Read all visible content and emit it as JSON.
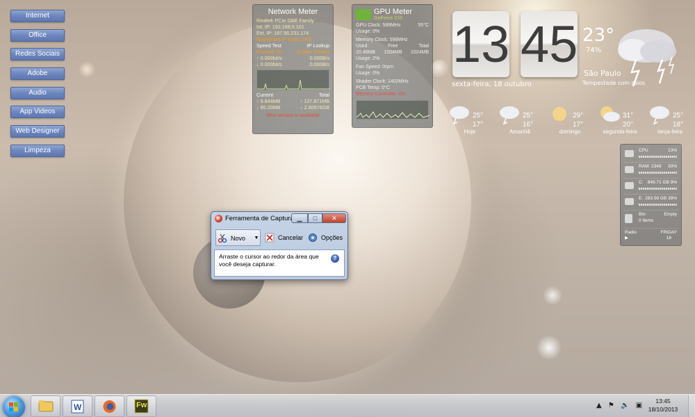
{
  "launcher": {
    "items": [
      "Internet",
      "Office",
      "Redes Sociais",
      "Adobe",
      "Audio",
      "App Videos",
      "Web Designer",
      "Limpeza"
    ]
  },
  "network_meter": {
    "title": "Network Meter",
    "adapter": "Realtek PCIe GBE Family",
    "int_ip": "Int. IP: 192.168.0.101",
    "ext_ip": "Ext. IP: 187.56.231.174",
    "blacklist": "Blacklisted IP Ratio: 2/69",
    "speed_test": "Speed Test",
    "ip_lookup": "IP Lookup",
    "firewall": "Firewall: On",
    "profile": "Profile: Private",
    "up_bit": "0.000bit/s",
    "up_b": "0.000B/s",
    "down_bit": "0.000bit/s",
    "down_b": "0.000B/s",
    "current_label": "Current",
    "total_label": "Total",
    "cur_up": "9.844MB",
    "tot_up": "137.871MB",
    "cur_down": "86.20MB",
    "tot_down": "2.60676GB",
    "new_version": "New version is available"
  },
  "gpu_meter": {
    "title": "GPU Meter",
    "model": "GeForce 210",
    "gpu_clock": "GPU Clock: 589MHz",
    "gpu_temp": "55°C",
    "usage1": "Usage: 0%",
    "memory_clock": "Memory Clock: 598MHz",
    "col_used": "Used",
    "col_free": "Free",
    "col_total": "Total",
    "mem_used": "20.48MB",
    "mem_free": "1004MB",
    "mem_total": "1024MB",
    "usage2": "Usage: 2%",
    "fan_speed": "Fan Speed: 0rpm",
    "usage3": "Usage: 0%",
    "shader_clock": "Shader Clock: 1402MHz",
    "pcb_temp": "PCB Temp: 0°C",
    "mem_controller": "Memory Controller: 0%"
  },
  "clock": {
    "hour": "13",
    "minute": "45",
    "date": "sexta-feira, 18 outubro"
  },
  "weather": {
    "temp": "23°",
    "humidity": "74%",
    "city": "São Paulo",
    "condition": "Tempestade com raios",
    "forecast": [
      {
        "day": "Hoje",
        "hi": "25°",
        "lo": "17°",
        "icon": "storm-cloud-icon"
      },
      {
        "day": "Amanhã",
        "hi": "25°",
        "lo": "16°",
        "icon": "storm-cloud-icon"
      },
      {
        "day": "domingo",
        "hi": "29°",
        "lo": "17°",
        "icon": "sun-icon"
      },
      {
        "day": "segunda-feira",
        "hi": "31°",
        "lo": "20°",
        "icon": "partly-sunny-icon"
      },
      {
        "day": "terça-feira",
        "hi": "25°",
        "lo": "18°",
        "icon": "storm-cloud-icon"
      }
    ]
  },
  "system_monitor": {
    "cpu_label": "CPU",
    "cpu_val": "13%",
    "ram_label": "RAM: 2349",
    "ram_val": "30%",
    "c_label": "C:",
    "c_val": "849.71 GB 9%",
    "e_label": "E:",
    "e_val": "283.56 GB 39%",
    "bin_label": "Bin:",
    "bin_val": "Empty",
    "bin_items": "0 Items",
    "radio": "Radio",
    "day": "FRIDAY",
    "day_num": "18"
  },
  "snipping_tool": {
    "title": "Ferramenta de Captura",
    "new": "Novo",
    "cancel": "Cancelar",
    "options": "Opções",
    "instruction": "Arraste o cursor ao redor da área que você deseja capturar."
  },
  "taskbar": {
    "apps": [
      "File Explorer",
      "Microsoft Word",
      "Firefox",
      "Fireworks"
    ],
    "fireworks_label": "Fw",
    "time": "13:45",
    "date": "18/10/2013"
  },
  "colors": {
    "launcher_button": "#6d86bd",
    "gpu_logo": "#6fb33a",
    "close_button": "#c2402b"
  }
}
